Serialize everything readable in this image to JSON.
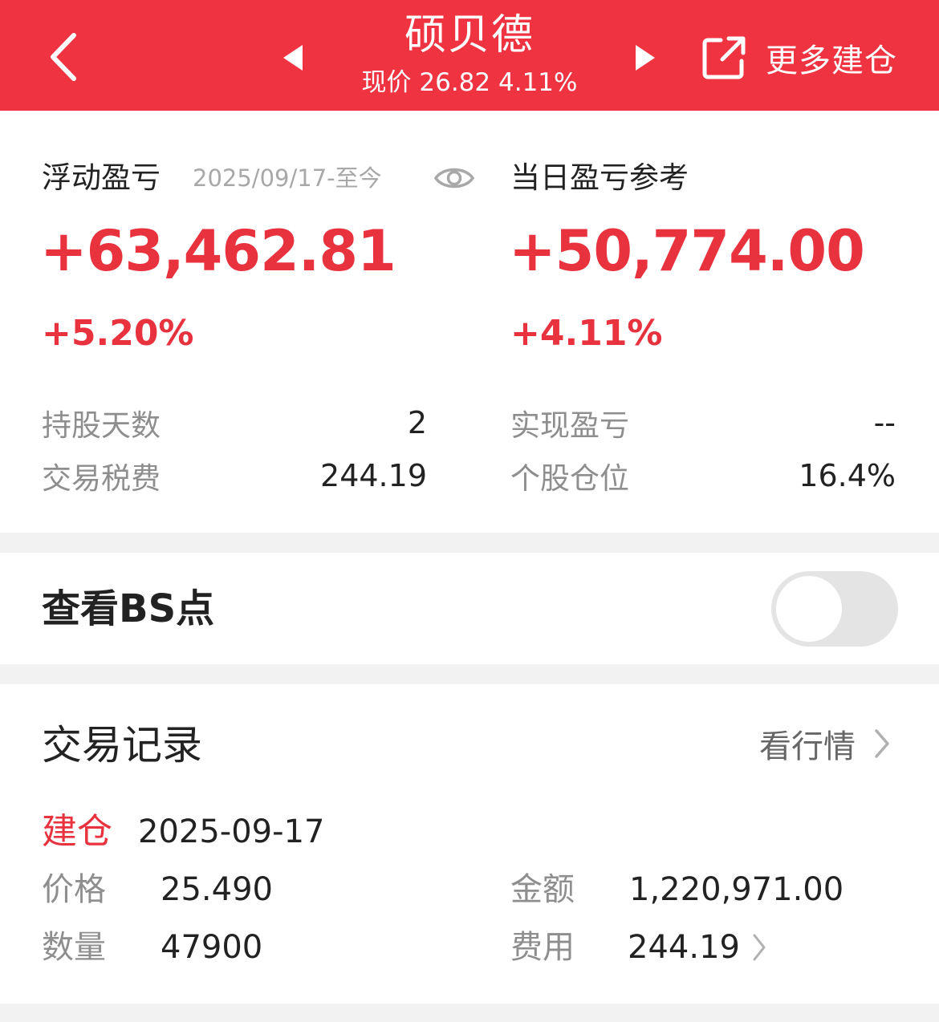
{
  "header": {
    "title": "硕贝德",
    "subtitle": "现价 26.82 4.11%",
    "more_label": "更多建仓"
  },
  "summary": {
    "floating_label": "浮动盈亏",
    "date_range": "2025/09/17-至今",
    "floating_value": "+63,462.81",
    "floating_pct": "+5.20%",
    "daily_label": "当日盈亏参考",
    "daily_value": "+50,774.00",
    "daily_pct": "+4.11%",
    "stats": {
      "hold_days_label": "持股天数",
      "hold_days_value": "2",
      "tax_label": "交易税费",
      "tax_value": "244.19",
      "realized_label": "实现盈亏",
      "realized_value": "--",
      "position_label": "个股仓位",
      "position_value": "16.4%"
    }
  },
  "bs_points": {
    "label": "查看BS点",
    "enabled": false
  },
  "trade_records": {
    "title": "交易记录",
    "quote_link": "看行情",
    "record": {
      "type": "建仓",
      "date": "2025-09-17",
      "price_label": "价格",
      "price_value": "25.490",
      "qty_label": "数量",
      "qty_value": "47900",
      "amount_label": "金额",
      "amount_value": "1,220,971.00",
      "fee_label": "费用",
      "fee_value": "244.19"
    }
  },
  "colors": {
    "header_bg": "#ef3340",
    "profit": "#e8323e",
    "muted": "#8e8e8e"
  },
  "icons": [
    "back-arrow-icon",
    "prev-triangle-icon",
    "next-triangle-icon",
    "external-link-icon",
    "eye-icon",
    "chevron-right-icon"
  ]
}
